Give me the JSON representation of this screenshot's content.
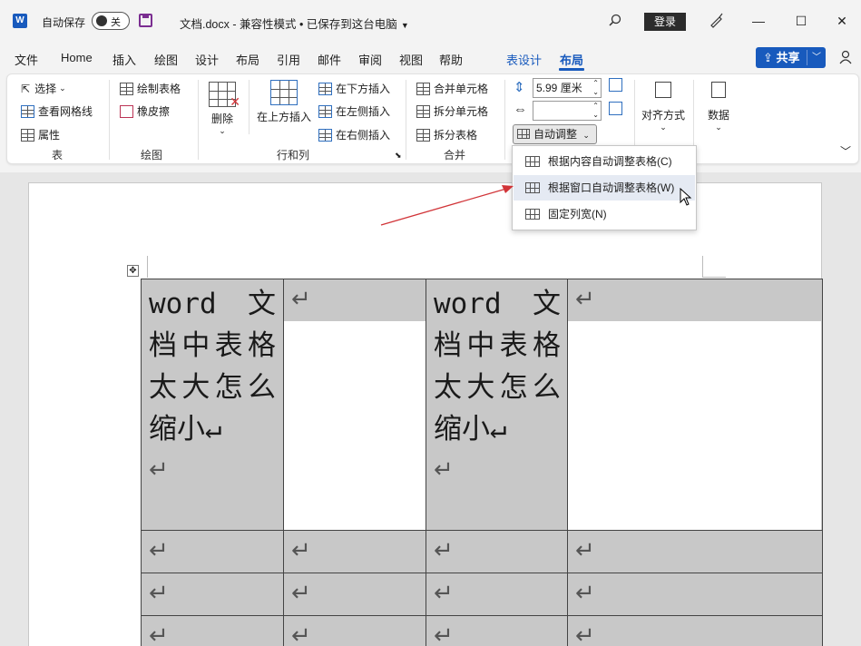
{
  "titlebar": {
    "autosave_label": "自动保存",
    "autosave_state": "关",
    "doc_title": "文档.docx  -  兼容性模式 • 已保存到这台电脑",
    "login": "登录",
    "minimize": "—",
    "maximize": "☐",
    "close": "✕"
  },
  "menu": {
    "items": [
      "文件",
      "Home",
      "插入",
      "绘图",
      "设计",
      "布局",
      "引用",
      "邮件",
      "审阅",
      "视图",
      "帮助",
      "表设计",
      "布局"
    ],
    "share": "共享"
  },
  "ribbon": {
    "table_group": {
      "select": "选择",
      "gridlines": "查看网格线",
      "properties": "属性",
      "label": "表"
    },
    "draw_group": {
      "draw_table": "绘制表格",
      "eraser": "橡皮擦",
      "label": "绘图"
    },
    "rows_cols_group": {
      "delete": "删除",
      "insert_above": "在上方插入",
      "insert_below": "在下方插入",
      "insert_left": "在左侧插入",
      "insert_right": "在右侧插入",
      "label": "行和列"
    },
    "merge_group": {
      "merge_cells": "合并单元格",
      "split_cells": "拆分单元格",
      "split_table": "拆分表格",
      "label": "合并"
    },
    "cell_size_group": {
      "height_value": "5.99 厘米",
      "width_value": "",
      "autofit": "自动调整"
    },
    "alignment": "对齐方式",
    "data": "数据"
  },
  "autofit_menu": {
    "items": [
      {
        "label": "根据内容自动调整表格(C)",
        "hover": false
      },
      {
        "label": "根据窗口自动调整表格(W)",
        "hover": true
      },
      {
        "label": "固定列宽(N)",
        "hover": false
      }
    ]
  },
  "document": {
    "cell_text_1": "word 文档中表格太大怎么缩小↵",
    "return_mark": "↵"
  },
  "colors": {
    "accent": "#185abd",
    "cell_highlight": "#c8c8c8",
    "annotation_arrow": "#d13438"
  }
}
